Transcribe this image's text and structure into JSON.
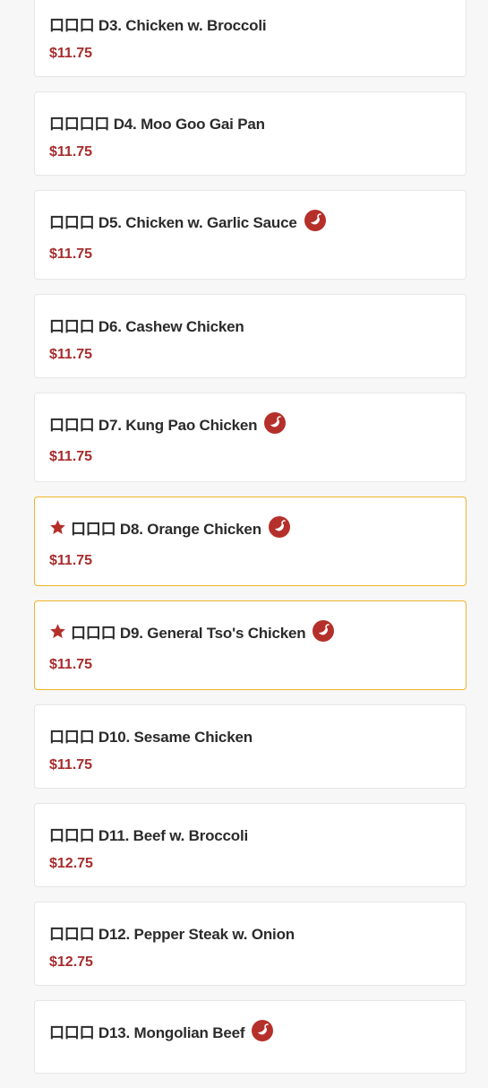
{
  "colors": {
    "price": "#a72c2c",
    "featured_border": "#f0b429",
    "spicy_icon": "#b5302a",
    "star": "#b5302a"
  },
  "items": [
    {
      "name": "口口口 D3. Chicken w. Broccoli",
      "price": "$11.75",
      "spicy": false,
      "featured": false
    },
    {
      "name": "口口口口 D4. Moo Goo Gai Pan",
      "price": "$11.75",
      "spicy": false,
      "featured": false
    },
    {
      "name": "口口口 D5. Chicken w. Garlic Sauce",
      "price": "$11.75",
      "spicy": true,
      "featured": false
    },
    {
      "name": "口口口 D6. Cashew Chicken",
      "price": "$11.75",
      "spicy": false,
      "featured": false
    },
    {
      "name": "口口口 D7. Kung Pao Chicken",
      "price": "$11.75",
      "spicy": true,
      "featured": false
    },
    {
      "name": "口口口 D8. Orange Chicken",
      "price": "$11.75",
      "spicy": true,
      "featured": true
    },
    {
      "name": "口口口 D9. General Tso's Chicken",
      "price": "$11.75",
      "spicy": true,
      "featured": true
    },
    {
      "name": "口口口 D10. Sesame Chicken",
      "price": "$11.75",
      "spicy": false,
      "featured": false
    },
    {
      "name": "口口口 D11. Beef w. Broccoli",
      "price": "$12.75",
      "spicy": false,
      "featured": false
    },
    {
      "name": "口口口 D12. Pepper Steak w. Onion",
      "price": "$12.75",
      "spicy": false,
      "featured": false
    },
    {
      "name": "口口口 D13. Mongolian Beef",
      "price": "",
      "spicy": true,
      "featured": false
    }
  ]
}
